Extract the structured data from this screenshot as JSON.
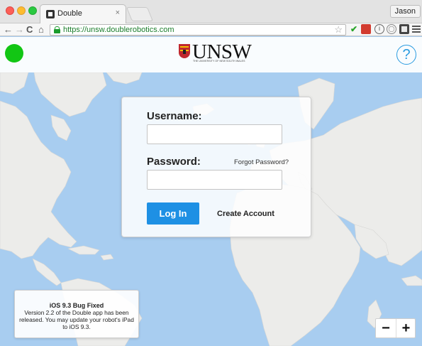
{
  "browser": {
    "tab_title": "Double",
    "tab_close": "×",
    "profile_name": "Jason",
    "url": "https://unsw.doublerobotics.com",
    "nav_back": "←",
    "nav_forward": "→",
    "nav_reload": "C",
    "nav_home": "⌂",
    "bookmark_star": "☆",
    "extensions": [
      "checkmark-icon",
      "red-extension-icon",
      "info-icon",
      "circle-extension-icon",
      "dark-extension-icon",
      "menu-icon"
    ]
  },
  "header": {
    "status_color": "#12c614",
    "logo_text": "UNSW",
    "logo_subtext": "THE UNIVERSITY OF NEW SOUTH WALES",
    "help_label": "?"
  },
  "login": {
    "username_label": "Username:",
    "username_value": "",
    "password_label": "Password:",
    "password_value": "",
    "forgot_password": "Forgot Password?",
    "login_button": "Log In",
    "create_account": "Create Account"
  },
  "notice": {
    "title": "iOS 9.3 Bug Fixed",
    "body": "Version 2.2 of the Double app has been released. You may update your robot's iPad to iOS 9.3."
  },
  "zoom": {
    "out_label": "−",
    "in_label": "+"
  },
  "colors": {
    "accent": "#1e90e4",
    "water": "#a8cdf0",
    "land": "#ececea",
    "status": "#12c614"
  }
}
